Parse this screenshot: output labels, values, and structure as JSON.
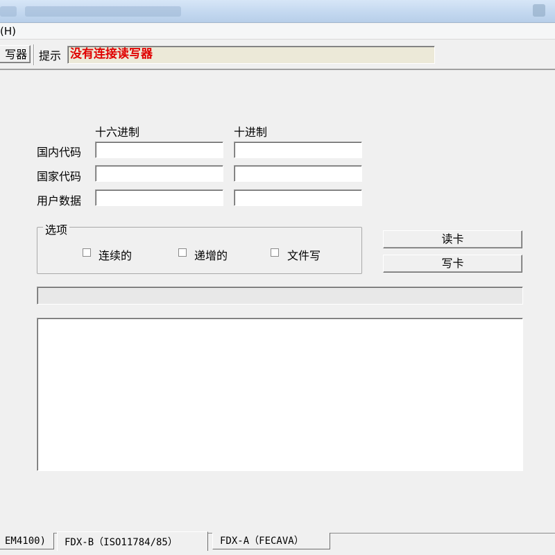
{
  "menu": {
    "help": "(H)"
  },
  "toolbar": {
    "reader_button": "写器",
    "hint_label": "提示",
    "hint_text": "没有连接读写器",
    "hint_color": "#e00000"
  },
  "form": {
    "col_hex": "十六进制",
    "col_dec": "十进制",
    "rows": [
      {
        "label": "国内代码",
        "hex": "",
        "dec": ""
      },
      {
        "label": "国家代码",
        "hex": "",
        "dec": ""
      },
      {
        "label": "用户数据",
        "hex": "",
        "dec": ""
      }
    ]
  },
  "options": {
    "title": "选项",
    "items": [
      {
        "label": "连续的",
        "checked": false
      },
      {
        "label": "递增的",
        "checked": false
      },
      {
        "label": "文件写",
        "checked": false
      }
    ]
  },
  "buttons": {
    "read": "读卡",
    "write": "写卡"
  },
  "progress": 0,
  "log": "",
  "tabs": [
    {
      "label": "EM4100)",
      "active": false
    },
    {
      "label": "FDX-B（ISO11784/85）",
      "active": true
    },
    {
      "label": "FDX-A（FECAVA）",
      "active": false
    }
  ]
}
